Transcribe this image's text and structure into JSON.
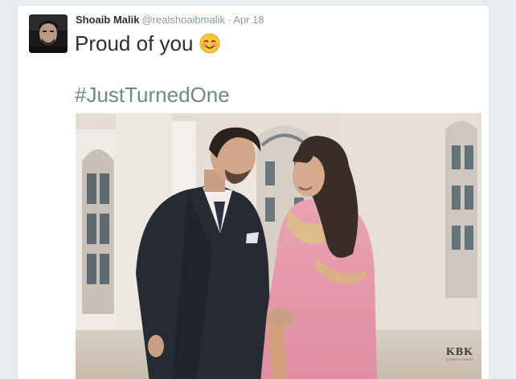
{
  "tweet": {
    "author_name": "Shoaib Malik",
    "author_handle": "@realshoaibmalik",
    "separator": "·",
    "timestamp": "Apr 18",
    "text": "Proud of you",
    "emoji": "smiling-face-with-blushing-cheeks",
    "hashtag": "#JustTurnedOne",
    "photo": {
      "description_icon": "photo-image",
      "watermark": "KBK",
      "watermark_sub": "CONSULTANTS"
    }
  },
  "colors": {
    "name": "#292f33",
    "meta": "#8899a6",
    "hashtag": "#6e8d78",
    "card_border": "#e1e8ed",
    "background": "#e8ecef"
  }
}
